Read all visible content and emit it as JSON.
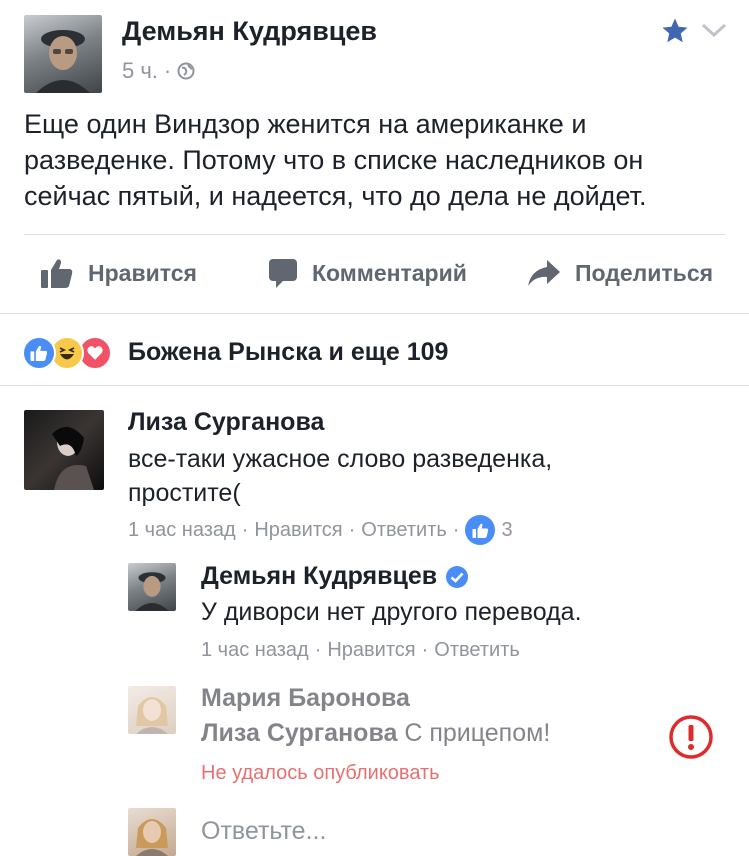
{
  "post": {
    "author": "Демьян Кудрявцев",
    "time": "5 ч.",
    "dot": "·",
    "text": "Еще один Виндзор женится на американке и разведенке. Потому что в списке наследников он сейчас пятый, и надеется, что до дела не дойдет."
  },
  "actions": {
    "like": "Нравится",
    "comment": "Комментарий",
    "share": "Поделиться"
  },
  "reactions": {
    "summary": "Божена Рынска и еще 109"
  },
  "comments": [
    {
      "author": "Лиза Сурганова",
      "text_line1": "все-таки ужасное слово разведенка,",
      "text_line2": "простите(",
      "time": "1 час назад",
      "like": "Нравится",
      "reply": "Ответить",
      "likes": "3",
      "sep": "·"
    },
    {
      "author": "Демьян Кудрявцев",
      "text": "У диворси нет другого перевода.",
      "time": "1 час назад",
      "like": "Нравится",
      "reply": "Ответить",
      "sep": "·"
    },
    {
      "author": "Мария Баронова",
      "mention": "Лиза Сурганова",
      "text": " С прицепом!",
      "error": "Не удалось опубликовать"
    }
  ],
  "reply_box": {
    "placeholder": "Ответьте..."
  },
  "colors": {
    "fb_blue": "#4267b2",
    "like_blue": "#4a8ef5",
    "love_red": "#f25268",
    "haha_yellow": "#f7c94b",
    "error_red": "#e02b2b",
    "muted": "#90949c"
  }
}
